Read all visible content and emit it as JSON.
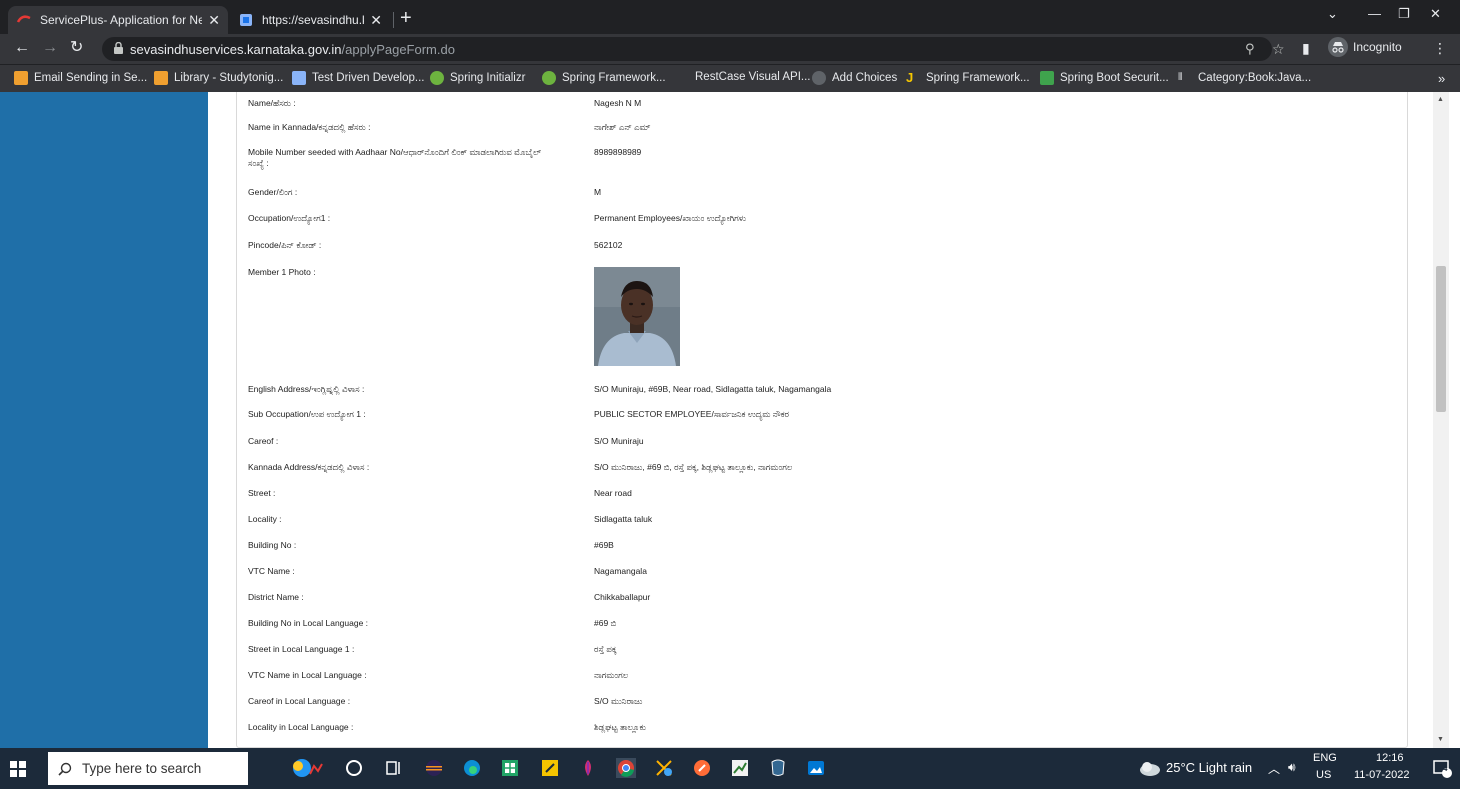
{
  "browser": {
    "tabs": [
      {
        "title": "ServicePlus- Application for New",
        "active": true
      },
      {
        "title": "https://sevasindhu.karnataka.gov",
        "active": false
      }
    ],
    "url_domain": "sevasindhuservices.karnataka.gov.in",
    "url_path": "/applyPageForm.do",
    "incognito_label": "Incognito"
  },
  "bookmarks": [
    "Email Sending in Se...",
    "Library - Studytonig...",
    "Test Driven Develop...",
    "Spring Initializr",
    "Spring Framework...",
    "RestCase Visual API...",
    "Add Choices",
    "Spring Framework...",
    "Spring Boot Securit...",
    "Category:Book:Java..."
  ],
  "form": {
    "fields": [
      {
        "label": "Name/ಹೆಸರು :",
        "value": "Nagesh N M"
      },
      {
        "label": "Name in Kannada/ಕನ್ನಡದಲ್ಲಿ ಹೆಸರು :",
        "value": "ನಾಗೇಶ್ ಎನ್ ಎಮ್"
      },
      {
        "label": "Mobile Number seeded with Aadhaar No/ಆಧಾರ್‌ನೊಂದಿಗೆ ಲಿಂಕ್ ಮಾಡಲಾಗಿರುವ ಮೊಬೈಲ್ ಸಂಖ್ಯೆ :",
        "value": "8989898989"
      },
      {
        "label": "Gender/ಲಿಂಗ :",
        "value": "M"
      },
      {
        "label": "Occupation/ಉದ್ಯೋಗ1 :",
        "value": "Permanent Employees/ಖಾಯಂ ಉದ್ಯೋಗಿಗಳು"
      },
      {
        "label": "Pincode/ಪಿನ್ ಕೋಡ್ :",
        "value": "562102"
      },
      {
        "label": "Member 1 Photo :",
        "value": ""
      },
      {
        "label": "English Address/ಇಂಗ್ಲಿಷ್ನಲ್ಲಿ ವಿಳಾಸ :",
        "value": "S/O Muniraju, #69B, Near road, Sidlagatta taluk, Nagamangala"
      },
      {
        "label": "Sub Occupation/ಉಪ ಉದ್ಯೋಗ 1 :",
        "value": "PUBLIC SECTOR EMPLOYEE/ಸಾರ್ವಜನಿಕ ಉದ್ಯಮ ನೌಕರ"
      },
      {
        "label": "Careof :",
        "value": "S/O Muniraju"
      },
      {
        "label": "Kannada Address/ಕನ್ನಡದಲ್ಲಿ ವಿಳಾಸ :",
        "value": "S/O ಮುನಿರಾಜು, #69 ಬಿ, ರಸ್ತೆ ಪಕ್ಕ, ಶಿಡ್ಲಘಟ್ಟ ತಾಲ್ಲೂಕು, ನಾಗಮಂಗಲ"
      },
      {
        "label": "Street :",
        "value": "Near road"
      },
      {
        "label": "Locality :",
        "value": "Sidlagatta taluk"
      },
      {
        "label": "Building No :",
        "value": "#69B"
      },
      {
        "label": "VTC Name :",
        "value": "Nagamangala"
      },
      {
        "label": "District Name :",
        "value": "Chikkaballapur"
      },
      {
        "label": "Building No in Local Language :",
        "value": "#69 ಬಿ"
      },
      {
        "label": "Street in Local Language 1 :",
        "value": "ರಸ್ತೆ ಪಕ್ಕ"
      },
      {
        "label": "VTC Name in Local Language :",
        "value": "ನಾಗಮಂಗಲ"
      },
      {
        "label": "Careof in Local Language :",
        "value": "S/O ಮುನಿರಾಜು"
      },
      {
        "label": "Locality in Local Language :",
        "value": "ಶಿಡ್ಲಘಟ್ಟ ತಾಲ್ಲೂಕು"
      }
    ]
  },
  "taskbar": {
    "search_placeholder": "Type here to search",
    "weather": "25°C  Light rain",
    "lang_top": "ENG",
    "lang_bottom": "US",
    "time": "12:16",
    "date": "11-07-2022",
    "notification_count": "4"
  },
  "colors": {
    "sidebar": "#1f6fa8",
    "chrome_dark": "#202124",
    "chrome_toolbar": "#35363a",
    "taskbar": "#1c2a3a"
  }
}
